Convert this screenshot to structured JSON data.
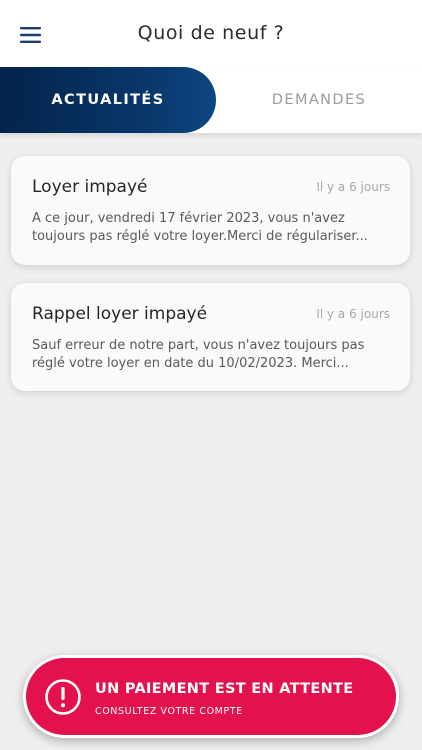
{
  "header": {
    "title": "Quoi de neuf ?",
    "menu_icon": "hamburger-menu-icon"
  },
  "tabs": [
    {
      "label": "ACTUALITÉS",
      "active": true
    },
    {
      "label": "DEMANDES",
      "active": false
    }
  ],
  "news": [
    {
      "title": "Loyer impayé",
      "time": "Il y a 6 jours",
      "body_line1": "A ce jour, vendredi 17 février 2023, vous n'avez",
      "body_line2": "toujours pas réglé votre loyer.Merci de régulariser..."
    },
    {
      "title": "Rappel loyer impayé",
      "time": "Il y a 6 jours",
      "body_line1": "Sauf erreur de notre part, vous n'avez toujours pas",
      "body_line2": "réglé votre loyer en date du 10/02/2023. Merci..."
    }
  ],
  "payment_banner": {
    "title": "UN PAIEMENT EST EN ATTENTE",
    "subtitle": "CONSULTEZ VOTRE COMPTE",
    "icon": "alert-circle-icon"
  },
  "colors": {
    "navy": "#03234a",
    "alert": "#e3124e",
    "background": "#efefef"
  }
}
